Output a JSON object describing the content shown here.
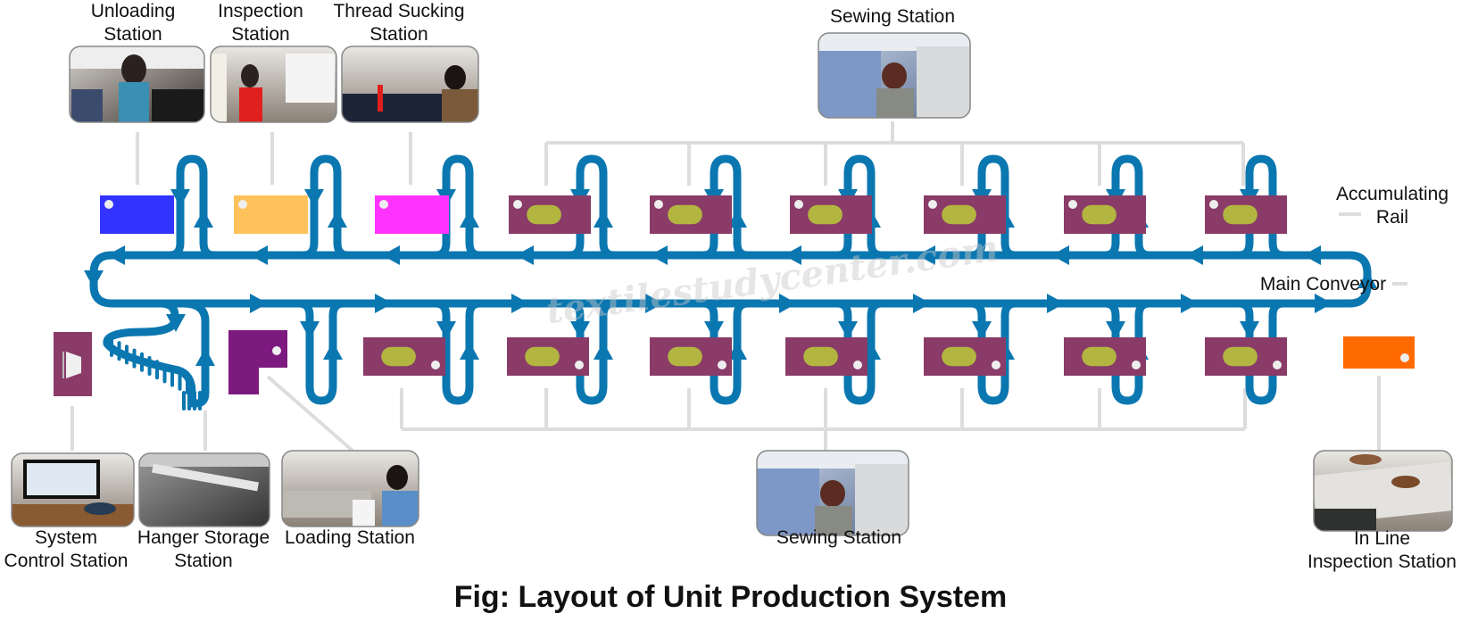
{
  "figure": {
    "caption": "Fig: Layout of Unit Production System",
    "watermark": "textilestudycenter.com"
  },
  "colors": {
    "conveyor": "#0b77b0",
    "connector": "#dddddd",
    "unloading": "#3333ff",
    "inspection": "#fdc25a",
    "thread_sucking": "#ff33ff",
    "sewing": "#8a3b68",
    "sewing_pad": "#b2b640",
    "loading": "#7d1a80",
    "system_control": "#8a3b68",
    "inline_inspection": "#ff6a00",
    "dot": "#eeeeee"
  },
  "labels": {
    "unloading": [
      "Unloading",
      "Station"
    ],
    "inspection": [
      "Inspection",
      "Station"
    ],
    "thread_sucking": [
      "Thread Sucking",
      "Station"
    ],
    "sewing_top": [
      "Sewing Station"
    ],
    "accumulating_rail": [
      "Accumulating",
      "Rail"
    ],
    "main_conveyor": [
      "Main Conveyor"
    ],
    "system_control": [
      "System",
      "Control Station"
    ],
    "hanger_storage": [
      "Hanger Storage",
      "Station"
    ],
    "loading": [
      "Loading Station"
    ],
    "sewing_bottom": [
      "Sewing Station"
    ],
    "inline_inspection": [
      "In Line",
      "Inspection Station"
    ]
  },
  "stations": {
    "top_row": [
      "unloading",
      "inspection",
      "thread_sucking",
      "sewing",
      "sewing",
      "sewing",
      "sewing",
      "sewing",
      "sewing"
    ],
    "bottom_row": [
      "sewing",
      "sewing",
      "sewing",
      "sewing",
      "sewing",
      "sewing",
      "sewing"
    ],
    "extra": [
      "system_control",
      "hanger_storage",
      "loading",
      "inline_inspection"
    ]
  },
  "photos": [
    {
      "id": "unloading",
      "subject": "worker unloading garments from hangers"
    },
    {
      "id": "inspection",
      "subject": "worker inspecting garments"
    },
    {
      "id": "thread_sucking",
      "subject": "worker at thread sucking machine"
    },
    {
      "id": "sewing_top",
      "subject": "operator at sewing machine with hanging garments"
    },
    {
      "id": "system_control",
      "subject": "computer monitor control station"
    },
    {
      "id": "hanger_storage",
      "subject": "hanger storage rail"
    },
    {
      "id": "loading",
      "subject": "worker loading garments onto hangers"
    },
    {
      "id": "sewing_bottom",
      "subject": "operator at sewing machine with hanging garments"
    },
    {
      "id": "inline_inspection",
      "subject": "hands inspecting fabric pieces on table"
    }
  ]
}
